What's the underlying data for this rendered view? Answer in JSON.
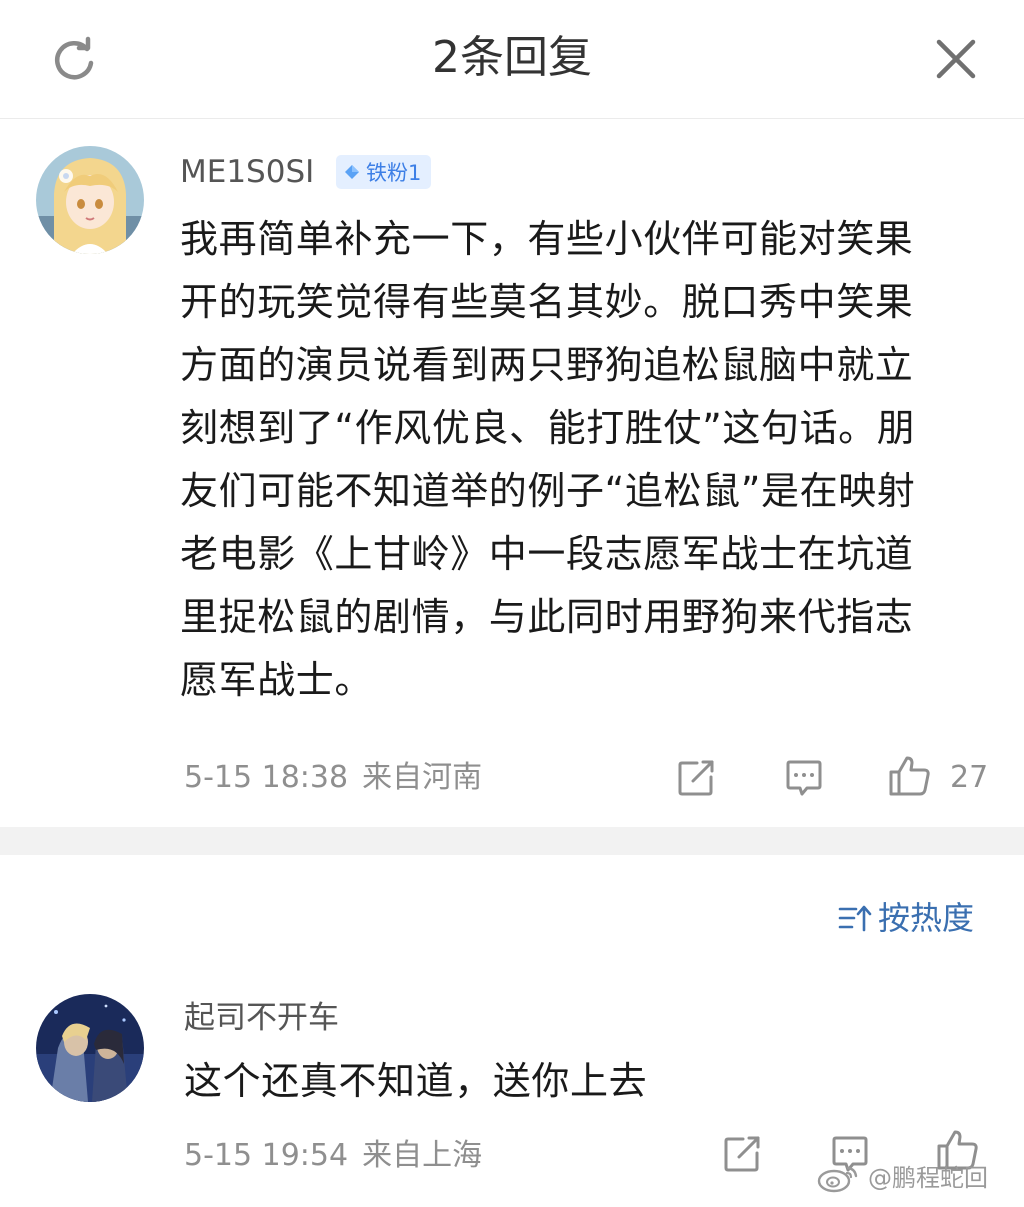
{
  "header": {
    "title": "2条回复",
    "refresh_icon": "refresh-icon",
    "close_icon": "close-icon"
  },
  "comments": [
    {
      "username": "ME1S0SI",
      "badge": "铁粉1",
      "text_lines": [
        "我再简单补充一下，有些小伙伴可能对笑果",
        "开的玩笑觉得有些莫名其妙。脱口秀中笑果",
        "方面的演员说看到两只野狗追松鼠脑中就立",
        "刻想到了“作风优良、能打胜仗”这句话。朋",
        "友们可能不知道举的例子“追松鼠”是在映射",
        "老电影《上甘岭》中一段志愿军战士在坑道",
        "里捉松鼠的剧情，与此同时用野狗来代指志",
        "愿军战士。"
      ],
      "time": "5-15 18:38",
      "location": "来自河南",
      "likes": "27"
    },
    {
      "username": "起司不开车",
      "text_lines": [
        "这个还真不知道，送你上去"
      ],
      "time": "5-15 19:54",
      "location": "来自上海"
    }
  ],
  "sort": {
    "label": "按热度"
  },
  "watermark": {
    "text": "@鹏程蛇回"
  },
  "colors": {
    "badge_bg": "#e4efff",
    "badge_text": "#3d7fe6",
    "sort_text": "#3a6fb0",
    "meta_text": "#8f8f8f",
    "divider": "#f2f2f2"
  }
}
